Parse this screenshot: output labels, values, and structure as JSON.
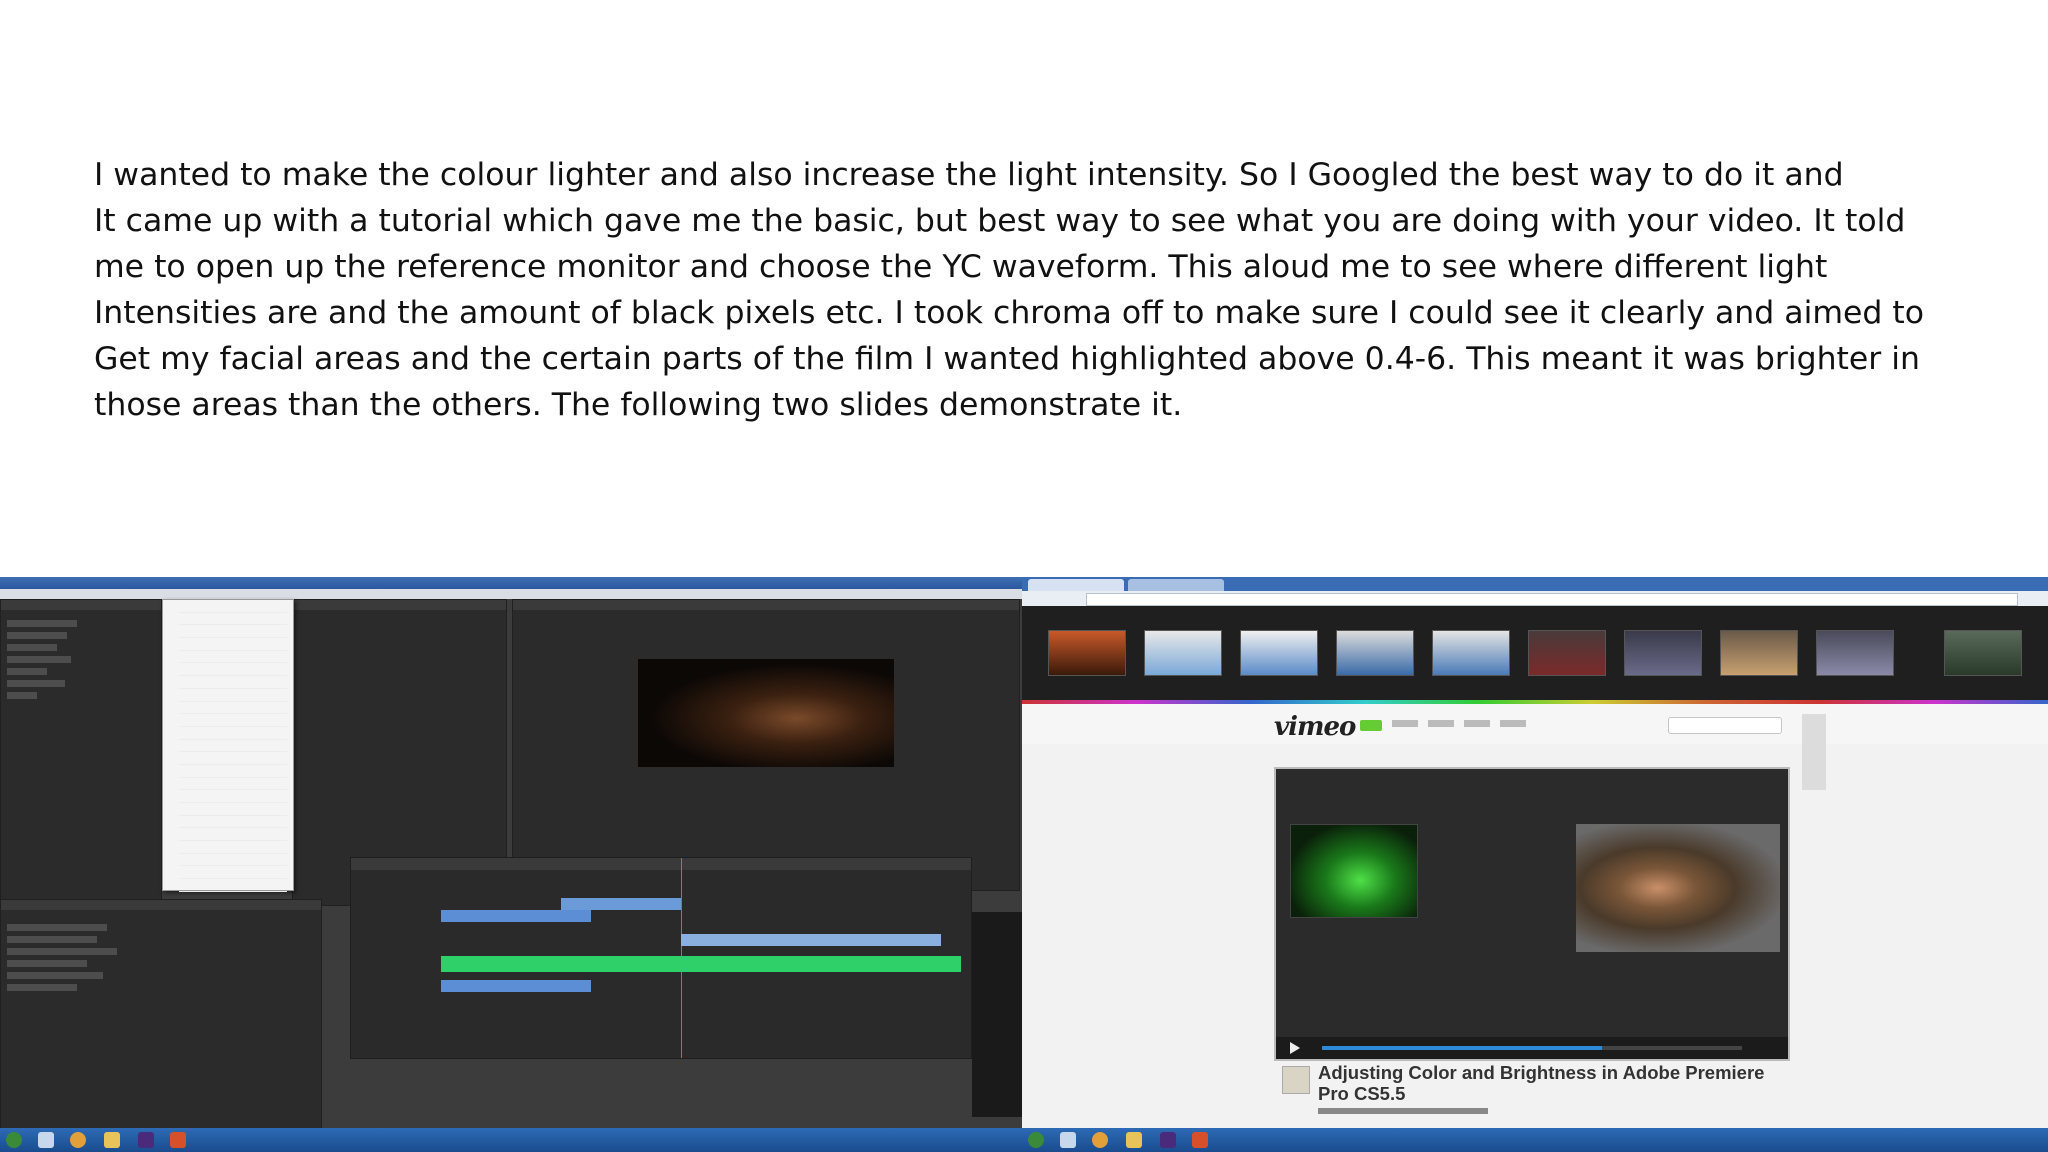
{
  "paragraph_lines": [
    "I wanted to make the colour lighter and also increase the light intensity.  So I  Googled the best way to do it and",
    "It came up with a tutorial which gave me the basic, but best way to see what you are doing with your video. It told",
    "me to open up the reference monitor and choose the YC  waveform. This aloud me to see  where different light",
    "Intensities are and the amount of black pixels etc. I took chroma off to make sure I could see it clearly and aimed to",
    "Get my facial areas and the certain parts of the film I wanted highlighted above 0.4-6. This meant it was brighter in",
    "those areas than the others. The following two slides demonstrate it."
  ],
  "left_screenshot": {
    "app": "Adobe Premiere Pro",
    "icon": "premiere-window"
  },
  "right_screenshot": {
    "logo": "vimeo",
    "video_title": "Adjusting Color and Brightness in Adobe Premiere Pro CS5.5",
    "icon": "browser-window"
  },
  "colors": {
    "taskbar": "#1f5aa3",
    "waveform_green": "#4fe048",
    "vimeo_join": "#66cc33"
  }
}
